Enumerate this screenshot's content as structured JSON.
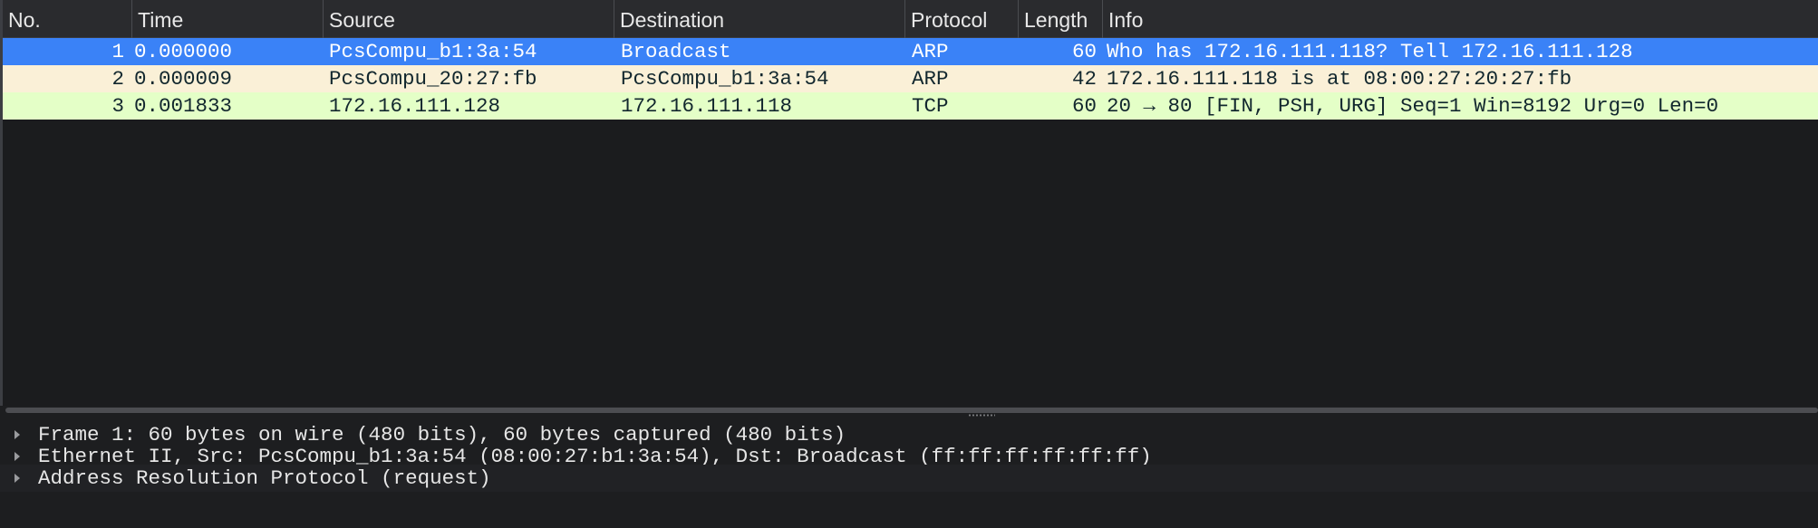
{
  "packet_list": {
    "columns": [
      "No.",
      "Time",
      "Source",
      "Destination",
      "Protocol",
      "Length",
      "Info"
    ],
    "rows": [
      {
        "no": "1",
        "time": "0.000000",
        "source": "PcsCompu_b1:3a:54",
        "destination": "Broadcast",
        "protocol": "ARP",
        "length": "60",
        "info": "Who has 172.16.111.118? Tell 172.16.111.128",
        "selected": true
      },
      {
        "no": "2",
        "time": "0.000009",
        "source": "PcsCompu_20:27:fb",
        "destination": "PcsCompu_b1:3a:54",
        "protocol": "ARP",
        "length": "42",
        "info": "172.16.111.118 is at 08:00:27:20:27:fb",
        "selected": false
      },
      {
        "no": "3",
        "time": "0.001833",
        "source": "172.16.111.128",
        "destination": "172.16.111.118",
        "protocol": "TCP",
        "length": "60",
        "info": "20 → 80 [FIN, PSH, URG] Seq=1 Win=8192 Urg=0 Len=0",
        "selected": false
      }
    ]
  },
  "colors": {
    "selected_row": "#3a82f7",
    "arp_row": "#faf0d7",
    "tcp_row": "#e4ffc7",
    "background": "#1b1c1e"
  },
  "detail_tree": {
    "items": [
      {
        "label": "Frame 1: 60 bytes on wire (480 bits), 60 bytes captured (480 bits)",
        "icon": "expand-triangle-icon"
      },
      {
        "label": "Ethernet II, Src: PcsCompu_b1:3a:54 (08:00:27:b1:3a:54), Dst: Broadcast (ff:ff:ff:ff:ff:ff)",
        "icon": "expand-triangle-icon"
      },
      {
        "label": "Address Resolution Protocol (request)",
        "icon": "expand-triangle-icon"
      }
    ]
  }
}
